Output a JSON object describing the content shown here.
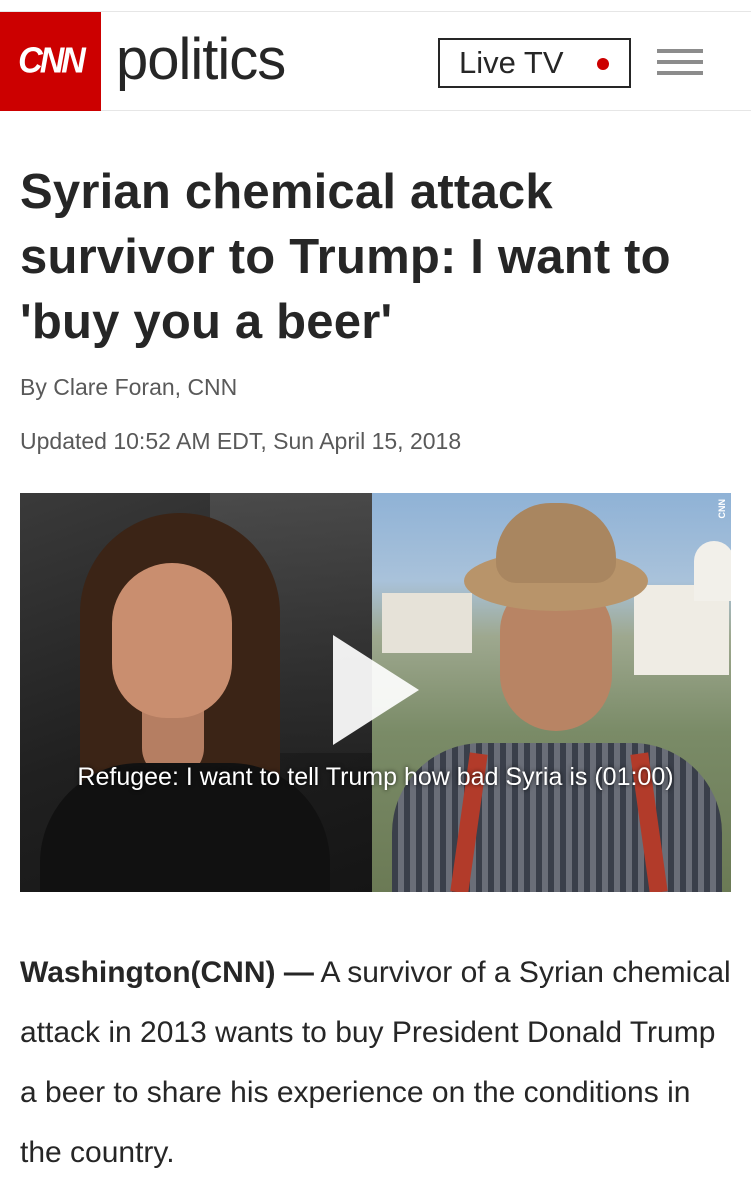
{
  "header": {
    "logo_text": "CNN",
    "section_title": "politics",
    "live_tv_label": "Live TV",
    "brand_color": "#cc0000",
    "menu_icon": "hamburger-menu-icon"
  },
  "article": {
    "headline": "Syrian chemical attack survivor to Trump: I want to 'buy you a beer'",
    "byline": "By Clare Foran, CNN",
    "updated": "Updated 10:52 AM EDT, Sun April 15, 2018",
    "video": {
      "caption": "Refugee: I want to tell Trump how bad Syria is (01:00)",
      "network_bug": "CNN",
      "play_icon": "play-icon"
    },
    "dateline": "Washington(CNN) —",
    "lead": " A survivor of a Syrian chemical attack in 2013 wants to buy President Donald Trump a beer to share his experience on the conditions in the country."
  }
}
